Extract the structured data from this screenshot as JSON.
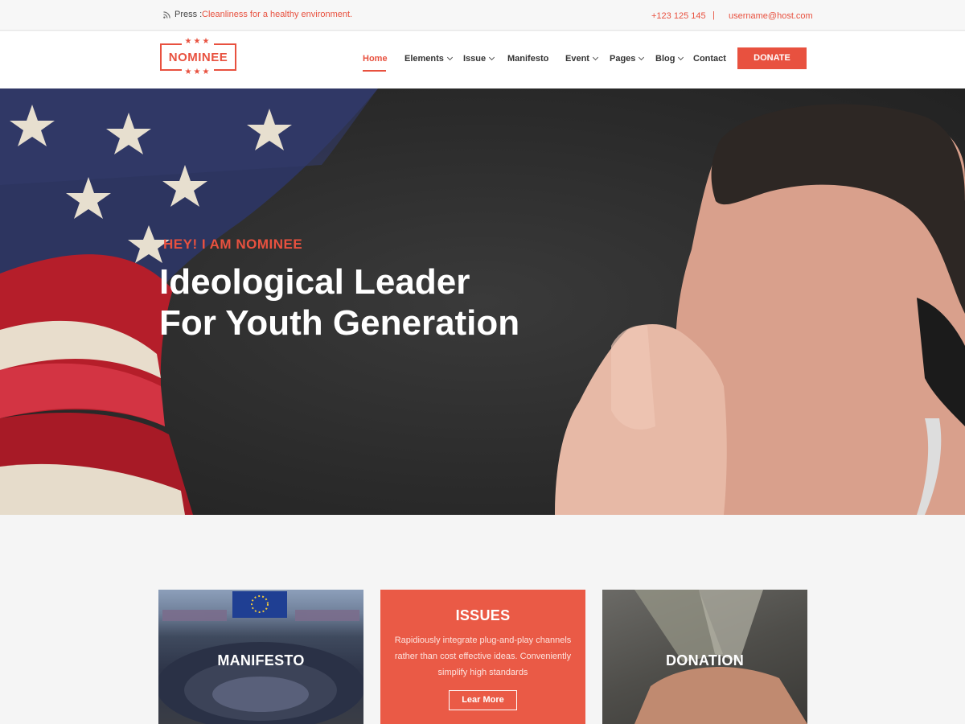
{
  "topbar": {
    "press_label": "Press :",
    "press_text": "Cleanliness for a healthy environment.",
    "phone": "+123 125 145",
    "separator": "|",
    "email": "username@host.com"
  },
  "header": {
    "logo_text": "NOMINEE",
    "logo_stars": "★★★",
    "nav": [
      {
        "label": "Home",
        "active": true,
        "dropdown": false
      },
      {
        "label": "Elements",
        "active": false,
        "dropdown": true
      },
      {
        "label": "Issue",
        "active": false,
        "dropdown": true
      },
      {
        "label": "Manifesto",
        "active": false,
        "dropdown": false
      },
      {
        "label": "Event",
        "active": false,
        "dropdown": true
      },
      {
        "label": "Pages",
        "active": false,
        "dropdown": true
      },
      {
        "label": "Blog",
        "active": false,
        "dropdown": true
      },
      {
        "label": "Contact",
        "active": false,
        "dropdown": false
      }
    ],
    "donate_label": "DONATE"
  },
  "hero": {
    "eyebrow": "HEY! I AM NOMINEE",
    "headline_line1": "Ideological Leader",
    "headline_line2": "For Youth Generation"
  },
  "cards": [
    {
      "title": "MANIFESTO"
    },
    {
      "title": "ISSUES",
      "description": "Rapidiously integrate plug-and-play channels rather than cost effective ideas. Conveniently simplify high standards",
      "button": "Lear More"
    },
    {
      "title": "DONATION"
    }
  ],
  "colors": {
    "accent": "#e8513f",
    "hero_bg": "#2b2b2b",
    "card_issue_bg": "#ea5a46"
  }
}
